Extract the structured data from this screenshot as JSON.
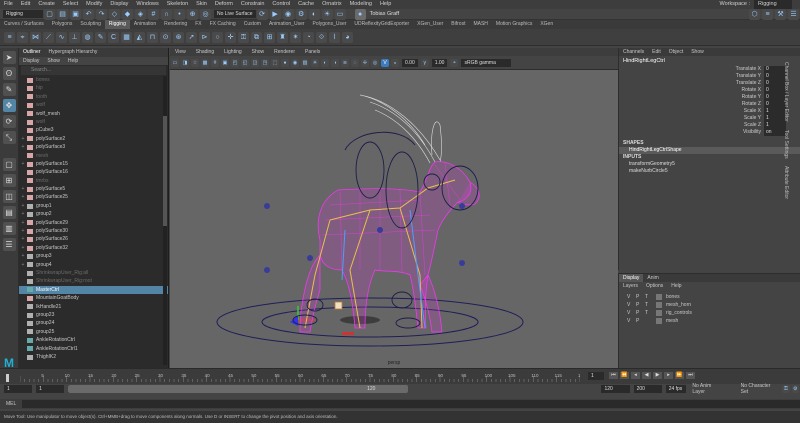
{
  "menubar": {
    "items": [
      "File",
      "Edit",
      "Create",
      "Select",
      "Modify",
      "Display",
      "Windows",
      "Skeleton",
      "Skin",
      "Deform",
      "Constrain",
      "Control",
      "Cache",
      "Ornatrix",
      "Modeling",
      "Help"
    ],
    "workspace_label": "Workspace :",
    "workspace_value": "Rigging"
  },
  "statusline": {
    "mode": "Rigging",
    "live_surface": "No Live Surface",
    "user": "Tobias Graff"
  },
  "shelf_tabs": [
    "Curves / Surfaces",
    "Polygons",
    "Sculpting",
    "Rigging",
    "Animation",
    "Rendering",
    "FX",
    "FX Caching",
    "Custom",
    "Animation_User",
    "Polygons_User",
    "UDReflexityGridExporter",
    "XGen_User",
    "Bifrost",
    "MASH",
    "Motion Graphics",
    "XGen"
  ],
  "shelf_active": "Rigging",
  "outliner": {
    "tabs": [
      "Outliner",
      "Hypergraph Hierarchy"
    ],
    "menu": [
      "Display",
      "Show",
      "Help"
    ],
    "search_placeholder": "Search...",
    "items": [
      {
        "name": "bones",
        "kind": "mesh",
        "dim": true
      },
      {
        "name": "hip",
        "kind": "mesh",
        "dim": true
      },
      {
        "name": "tooth",
        "kind": "mesh",
        "dim": true
      },
      {
        "name": "wolf",
        "kind": "mesh",
        "dim": true
      },
      {
        "name": "wolf_mesh",
        "kind": "mesh",
        "dim": false
      },
      {
        "name": "wolf",
        "kind": "mesh",
        "dim": true
      },
      {
        "name": "pCube3",
        "kind": "mesh",
        "dim": false
      },
      {
        "name": "polySurface2",
        "kind": "mesh",
        "dim": false,
        "plus": true
      },
      {
        "name": "polySurface3",
        "kind": "mesh",
        "dim": false,
        "plus": true
      },
      {
        "name": "mesh",
        "kind": "mesh",
        "dim": true
      },
      {
        "name": "polySurface15",
        "kind": "mesh",
        "dim": false,
        "plus": true
      },
      {
        "name": "polySurface16",
        "kind": "mesh",
        "dim": false
      },
      {
        "name": "tmrbs",
        "kind": "mesh",
        "dim": true
      },
      {
        "name": "polySurface5",
        "kind": "mesh",
        "dim": false,
        "plus": true
      },
      {
        "name": "polySurface25",
        "kind": "mesh",
        "dim": false,
        "plus": true
      },
      {
        "name": "group1",
        "kind": "grp",
        "dim": false,
        "plus": true
      },
      {
        "name": "group2",
        "kind": "grp",
        "dim": false,
        "plus": true
      },
      {
        "name": "polySurface29",
        "kind": "mesh",
        "dim": false,
        "plus": true
      },
      {
        "name": "polySurface30",
        "kind": "mesh",
        "dim": false,
        "plus": true
      },
      {
        "name": "polySurface26",
        "kind": "mesh",
        "dim": false,
        "plus": true
      },
      {
        "name": "polySurface32",
        "kind": "mesh",
        "dim": false,
        "plus": true
      },
      {
        "name": "group3",
        "kind": "grp",
        "dim": false,
        "plus": true
      },
      {
        "name": "group4",
        "kind": "grp",
        "dim": false,
        "plus": true
      },
      {
        "name": "ShrinkwrapUser_Rig:all",
        "kind": "grp",
        "dim": true
      },
      {
        "name": "ShrinkwrapUser_Rig:root",
        "kind": "grp",
        "dim": true
      },
      {
        "name": "MasterCtrl",
        "kind": "ctrl",
        "dim": false,
        "selected": true
      },
      {
        "name": "MountainGoatBody",
        "kind": "mesh",
        "dim": false
      },
      {
        "name": "IkHandle21",
        "kind": "grp",
        "dim": false
      },
      {
        "name": "group23",
        "kind": "grp",
        "dim": false
      },
      {
        "name": "group24",
        "kind": "grp",
        "dim": false
      },
      {
        "name": "group25",
        "kind": "grp",
        "dim": false
      },
      {
        "name": "AnkleRotationCtrl",
        "kind": "ctrl",
        "dim": false
      },
      {
        "name": "AnkleRotationCtrl1",
        "kind": "ctrl",
        "dim": false
      },
      {
        "name": "ThighIK2",
        "kind": "grp",
        "dim": false
      }
    ]
  },
  "viewport": {
    "menu": [
      "View",
      "Shading",
      "Lighting",
      "Show",
      "Renderer",
      "Panels"
    ],
    "near_value": "0.00",
    "far_value": "1.00",
    "color_space": "sRGB gamma",
    "camera_label": "persp"
  },
  "channelbox": {
    "tabs": [
      "Channels",
      "Edit",
      "Object",
      "Show"
    ],
    "object_name": "HindRightLegCtrl",
    "attributes": [
      {
        "name": "Translate X",
        "value": "0"
      },
      {
        "name": "Translate Y",
        "value": "0"
      },
      {
        "name": "Translate Z",
        "value": "0"
      },
      {
        "name": "Rotate X",
        "value": "0"
      },
      {
        "name": "Rotate Y",
        "value": "0"
      },
      {
        "name": "Rotate Z",
        "value": "0"
      },
      {
        "name": "Scale X",
        "value": "1"
      },
      {
        "name": "Scale Y",
        "value": "1"
      },
      {
        "name": "Scale Z",
        "value": "1"
      },
      {
        "name": "Visibility",
        "value": "on"
      }
    ],
    "shapes_header": "SHAPES",
    "shape_name": "HindRightLegCtrlShape",
    "inputs_header": "INPUTS",
    "inputs": [
      "transformGeometry5",
      "makeNurbCircle5"
    ]
  },
  "side_tabs": [
    "Channel Box / Layer Editor",
    "Tool Settings",
    "Attribute Editor"
  ],
  "layers": {
    "tabs": [
      "Display",
      "Anim"
    ],
    "active_tab": "Display",
    "menu": [
      "Layers",
      "Options",
      "Help"
    ],
    "rows": [
      {
        "v": "V",
        "p": "P",
        "t": "T",
        "name": "bones"
      },
      {
        "v": "V",
        "p": "P",
        "t": "T",
        "name": "mesh_horn"
      },
      {
        "v": "V",
        "p": "P",
        "t": "T",
        "name": "rig_controls"
      },
      {
        "v": "V",
        "p": "P",
        "t": "",
        "name": "mesh"
      }
    ]
  },
  "timeline": {
    "ticks": [
      "5",
      "10",
      "15",
      "20",
      "25",
      "30",
      "35",
      "40",
      "45",
      "50",
      "55",
      "60",
      "65",
      "70",
      "75",
      "80",
      "85",
      "90",
      "95",
      "100",
      "105",
      "110",
      "115",
      "120"
    ],
    "current_frame": "1"
  },
  "range": {
    "start": "1",
    "playback_start": "1",
    "slider_value": "120",
    "playback_end": "120",
    "end": "200",
    "anim_layer": "No Anim Layer",
    "char_set": "No Character Set",
    "fps": "24 fps"
  },
  "cmdline": {
    "label": "MEL"
  },
  "helpline": {
    "text": "Move Tool: Use manipulator to move object(s). Ctrl+MMB+drag to move components along normals. Use D or INSERT to change the pivot position and axis orientation."
  },
  "colors": {
    "selection": "#5285a6",
    "wireframe": "#ff33ff",
    "viewport_bg": "#666666"
  }
}
